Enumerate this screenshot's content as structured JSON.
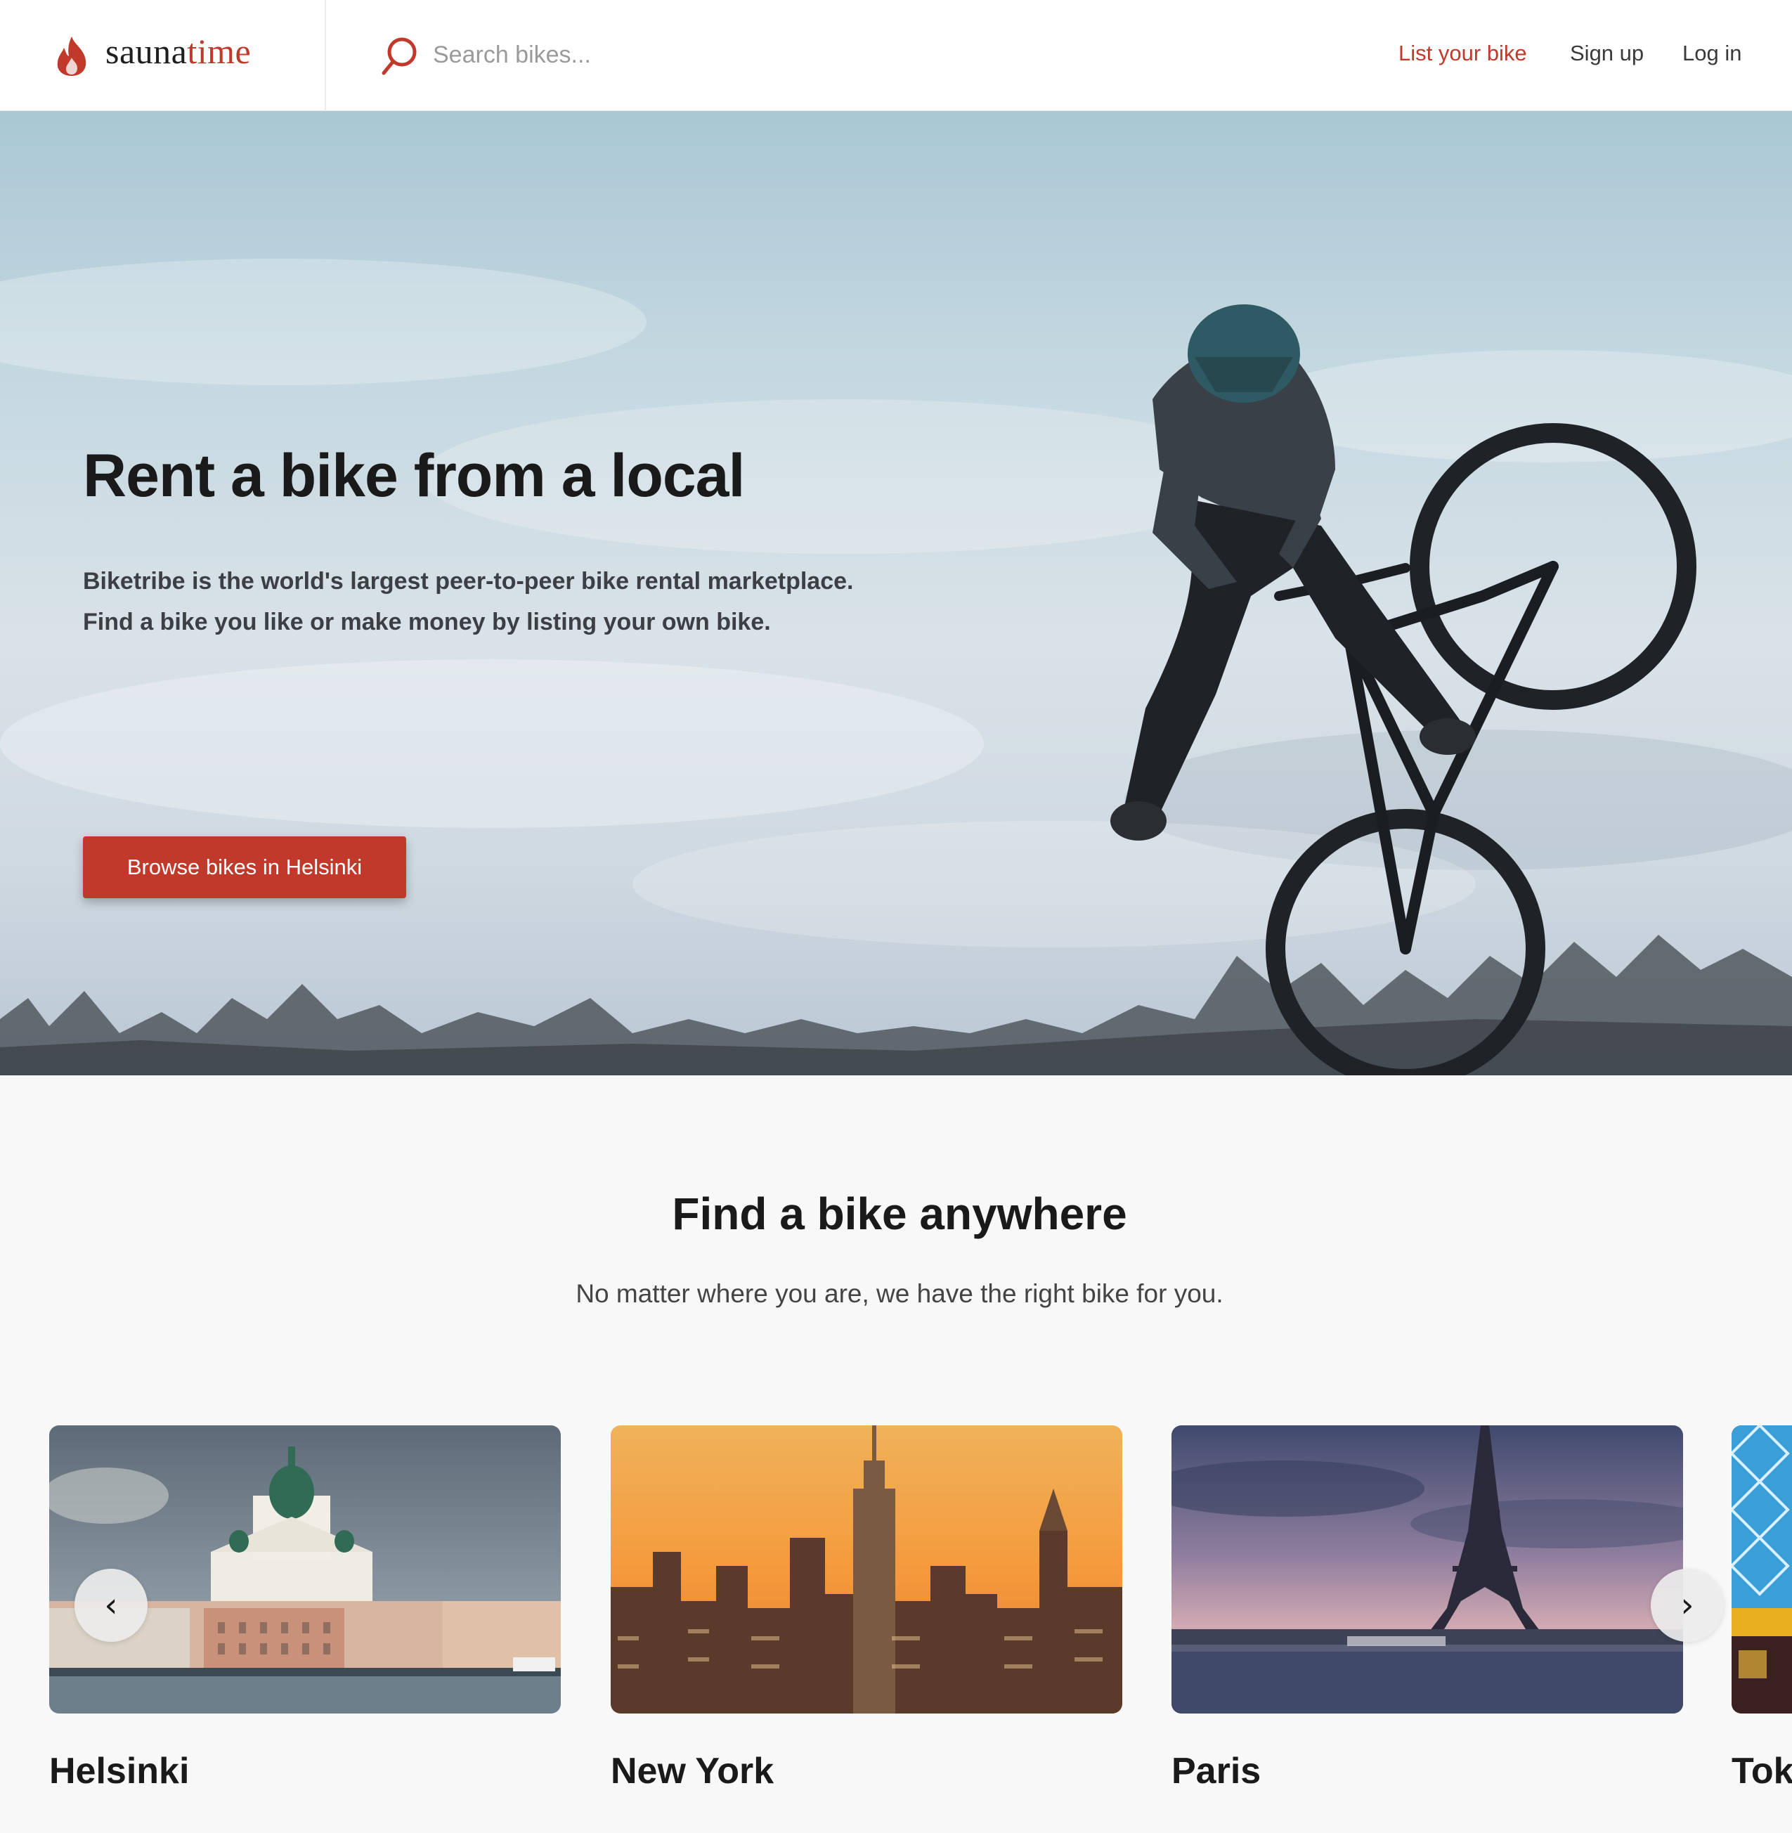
{
  "header": {
    "logo_part1": "sauna",
    "logo_part2": "time",
    "search_placeholder": "Search bikes...",
    "nav": {
      "list_bike": "List your bike",
      "sign_up": "Sign up",
      "log_in": "Log in"
    }
  },
  "hero": {
    "title": "Rent a bike from a local",
    "description": "Biketribe is the world's largest peer-to-peer bike rental marketplace. Find a bike you like or make money by listing your own bike.",
    "cta": "Browse bikes in Helsinki"
  },
  "locations": {
    "title": "Find a bike anywhere",
    "subtitle": "No matter where you are, we have the right bike for you.",
    "cities": [
      {
        "name": "Helsinki"
      },
      {
        "name": "New York"
      },
      {
        "name": "Paris"
      },
      {
        "name": "Tok"
      }
    ],
    "prev": "‹",
    "next": "›"
  },
  "colors": {
    "accent": "#c0392b",
    "background": "#f8f8f8",
    "text": "#1a1a1a"
  }
}
